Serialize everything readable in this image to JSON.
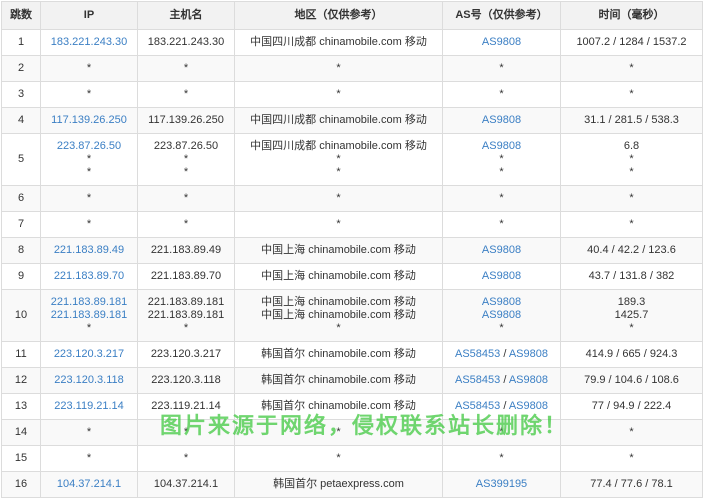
{
  "headers": [
    "跳数",
    "IP",
    "主机名",
    "地区（仅供参考）",
    "AS号（仅供参考）",
    "时间（毫秒）"
  ],
  "rows": [
    {
      "hop": "1",
      "ip": [
        "183.221.243.30"
      ],
      "host": [
        "183.221.243.30"
      ],
      "region": [
        "中国四川成都 chinamobile.com 移动"
      ],
      "as": [
        [
          "AS9808"
        ]
      ],
      "time": [
        "1007.2 / 1284 / 1537.2"
      ]
    },
    {
      "hop": "2",
      "ip": [
        "*"
      ],
      "host": [
        "*"
      ],
      "region": [
        "*"
      ],
      "as": [
        [
          "*"
        ]
      ],
      "time": [
        "*"
      ]
    },
    {
      "hop": "3",
      "ip": [
        "*"
      ],
      "host": [
        "*"
      ],
      "region": [
        "*"
      ],
      "as": [
        [
          "*"
        ]
      ],
      "time": [
        "*"
      ]
    },
    {
      "hop": "4",
      "ip": [
        "117.139.26.250"
      ],
      "host": [
        "117.139.26.250"
      ],
      "region": [
        "中国四川成都 chinamobile.com 移动"
      ],
      "as": [
        [
          "AS9808"
        ]
      ],
      "time": [
        "31.1 / 281.5 / 538.3"
      ]
    },
    {
      "hop": "5",
      "ip": [
        "223.87.26.50",
        "*",
        "*"
      ],
      "host": [
        "223.87.26.50",
        "*",
        "*"
      ],
      "region": [
        "中国四川成都 chinamobile.com 移动",
        "*",
        "*"
      ],
      "as": [
        [
          "AS9808"
        ],
        [
          "*"
        ],
        [
          "*"
        ]
      ],
      "time": [
        "6.8",
        "*",
        "*"
      ]
    },
    {
      "hop": "6",
      "ip": [
        "*"
      ],
      "host": [
        "*"
      ],
      "region": [
        "*"
      ],
      "as": [
        [
          "*"
        ]
      ],
      "time": [
        "*"
      ]
    },
    {
      "hop": "7",
      "ip": [
        "*"
      ],
      "host": [
        "*"
      ],
      "region": [
        "*"
      ],
      "as": [
        [
          "*"
        ]
      ],
      "time": [
        "*"
      ]
    },
    {
      "hop": "8",
      "ip": [
        "221.183.89.49"
      ],
      "host": [
        "221.183.89.49"
      ],
      "region": [
        "中国上海 chinamobile.com 移动"
      ],
      "as": [
        [
          "AS9808"
        ]
      ],
      "time": [
        "40.4 / 42.2 / 123.6"
      ]
    },
    {
      "hop": "9",
      "ip": [
        "221.183.89.70"
      ],
      "host": [
        "221.183.89.70"
      ],
      "region": [
        "中国上海 chinamobile.com 移动"
      ],
      "as": [
        [
          "AS9808"
        ]
      ],
      "time": [
        "43.7 / 131.8 / 382"
      ]
    },
    {
      "hop": "10",
      "ip": [
        "221.183.89.181",
        "221.183.89.181",
        "*"
      ],
      "host": [
        "221.183.89.181",
        "221.183.89.181",
        "*"
      ],
      "region": [
        "中国上海 chinamobile.com 移动",
        "中国上海 chinamobile.com 移动",
        "*"
      ],
      "as": [
        [
          "AS9808"
        ],
        [
          "AS9808"
        ],
        [
          "*"
        ]
      ],
      "time": [
        "189.3",
        "1425.7",
        "*"
      ]
    },
    {
      "hop": "11",
      "ip": [
        "223.120.3.217"
      ],
      "host": [
        "223.120.3.217"
      ],
      "region": [
        "韩国首尔 chinamobile.com 移动"
      ],
      "as": [
        [
          "AS58453",
          "AS9808"
        ]
      ],
      "time": [
        "414.9 / 665 / 924.3"
      ]
    },
    {
      "hop": "12",
      "ip": [
        "223.120.3.118"
      ],
      "host": [
        "223.120.3.118"
      ],
      "region": [
        "韩国首尔 chinamobile.com 移动"
      ],
      "as": [
        [
          "AS58453",
          "AS9808"
        ]
      ],
      "time": [
        "79.9 / 104.6 / 108.6"
      ]
    },
    {
      "hop": "13",
      "ip": [
        "223.119.21.14"
      ],
      "host": [
        "223.119.21.14"
      ],
      "region": [
        "韩国首尔 chinamobile.com 移动"
      ],
      "as": [
        [
          "AS58453",
          "AS9808"
        ]
      ],
      "time": [
        "77 / 94.9 / 222.4"
      ]
    },
    {
      "hop": "14",
      "ip": [
        "*"
      ],
      "host": [
        "*"
      ],
      "region": [
        "*"
      ],
      "as": [
        [
          "*"
        ]
      ],
      "time": [
        "*"
      ]
    },
    {
      "hop": "15",
      "ip": [
        "*"
      ],
      "host": [
        "*"
      ],
      "region": [
        "*"
      ],
      "as": [
        [
          "*"
        ]
      ],
      "time": [
        "*"
      ]
    },
    {
      "hop": "16",
      "ip": [
        "104.37.214.1"
      ],
      "host": [
        "104.37.214.1"
      ],
      "region": [
        "韩国首尔 petaexpress.com"
      ],
      "as": [
        [
          "AS399195"
        ]
      ],
      "time": [
        "77.4 / 77.6 / 78.1"
      ]
    }
  ],
  "watermark": "图片来源于网络，侵权联系站长删除！",
  "colors": {
    "link": "#3b7fc4",
    "header_bg": "#f2f2f2",
    "border": "#dcdcdc",
    "watermark": "#40c840"
  }
}
